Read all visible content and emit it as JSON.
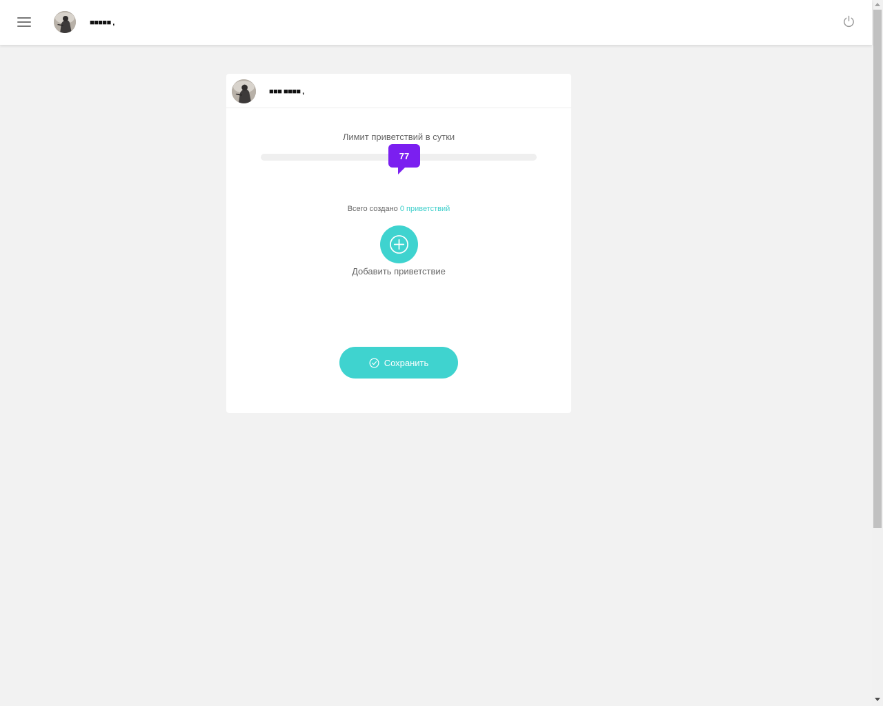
{
  "topbar": {
    "menu_icon": "hamburger-menu-icon",
    "username": "■■■■■ ,",
    "power_icon": "power-icon"
  },
  "card": {
    "username": "■■■ ■■■■ ,",
    "limit_label": "Лимит приветствий в сутки",
    "slider": {
      "value": "77",
      "fraction": 0.52
    },
    "total": {
      "prefix": "Всего создано",
      "link": "0 приветствий"
    },
    "add_icon": "plus-circle-icon",
    "add_label": "Добавить приветствие",
    "save_icon": "check-circle-icon",
    "save_label": "Сохранить"
  },
  "colors": {
    "accent": "#3fd3cf",
    "slider_handle": "#7b1ff0",
    "background": "#f2f2f2"
  }
}
